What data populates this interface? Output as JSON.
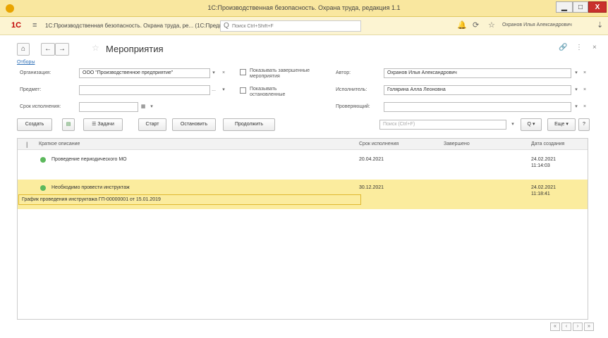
{
  "window": {
    "title": "1С:Производственная безопасность. Охрана труда, редакция 1.1",
    "min_glyph": "▁",
    "max_glyph": "□",
    "close_glyph": "X"
  },
  "appbar": {
    "logo": "1С",
    "title": "1С:Производственная безопасность. Охрана труда, ре... (1С:Предприятие)",
    "search_placeholder": "Поиск Ctrl+Shift+F",
    "user": "Охранов Илья Александрович"
  },
  "page": {
    "title": "Мероприятия",
    "selections_link": "Отборы"
  },
  "filters": {
    "organization_label": "Организация:",
    "organization_value": "ООО \"Производственное предприятие\"",
    "subject_label": "Предмет:",
    "subject_value": "",
    "deadline_label": "Срок исполнения:",
    "deadline_value": "",
    "show_completed_label": "Показывать завершенные мероприятия",
    "show_suspended_label": "Показывать остановленные",
    "author_label": "Автор:",
    "author_value": "Охранов Илья Александрович",
    "executor_label": "Исполнитель:",
    "executor_value": "Голярина Алла Леоновна",
    "checker_label": "Проверяющий:",
    "checker_value": ""
  },
  "toolbar": {
    "create": "Создать",
    "tasks": "Задачи",
    "start": "Старт",
    "stop": "Остановить",
    "continue": "Продолжить",
    "search_placeholder": "Поиск (Ctrl+F)",
    "more": "Еще"
  },
  "grid": {
    "columns": [
      "Краткое описание",
      "Срок исполнения",
      "Завершено",
      "Дата создания"
    ],
    "rows": [
      {
        "description": "Проведение периодического МО",
        "deadline": "20.04.2021",
        "completed": "",
        "created_date": "24.02.2021",
        "created_time": "11:14:03"
      },
      {
        "description": "Необходимо провести инструктаж",
        "deadline": "30.12.2021",
        "completed": "",
        "created_date": "24.02.2021",
        "created_time": "11:18:41"
      }
    ],
    "sub_item": "График проведения инструктажа ГП-00000001 от 15.01.2019"
  },
  "colors": {
    "title_bar": "#f9e79f",
    "selection": "#fbec9e",
    "status_active": "#5cb85c",
    "link": "#2d6fb7",
    "close_button": "#c9302c"
  },
  "icons": {
    "home": "⌂",
    "back": "←",
    "forward": "→",
    "star": "☆",
    "menu": "≡",
    "bell": "🔔",
    "history": "⟳",
    "favorites": "☆",
    "link": "🔗",
    "more": "⋮",
    "close": "×",
    "calendar": "▦",
    "search": "Q",
    "filter": "⇣",
    "ellipsis": "...",
    "dropdown": "▾",
    "clear": "×",
    "help": "?",
    "first_page": "«",
    "prev_page": "‹",
    "next_page": "›",
    "last_page": "»",
    "report": "▤",
    "tasks": "☰",
    "checkbox_mark": "☐"
  }
}
